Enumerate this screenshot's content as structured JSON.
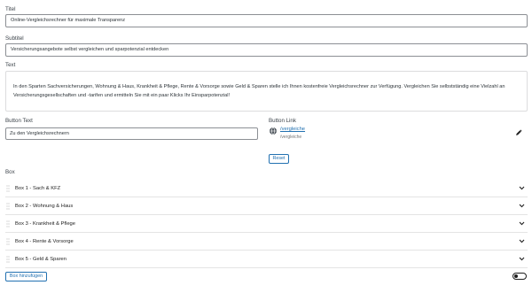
{
  "titel": {
    "label": "Titel",
    "value": "Online-Vergleichsrechner für maximale Transparenz"
  },
  "subtitel": {
    "label": "Subtitel",
    "value": "Versicherungsangebote selbst vergleichen und sparpotenzial entdecken"
  },
  "text": {
    "label": "Text",
    "value": "In den Sparten Sachversicherungen, Wohnung & Haus, Krankheit & Pflege, Rente & Vorsorge sowie Geld & Sparen stelle ich Ihnen kostenfreie Vergleichsrechner zur Verfügung. Vergleichen Sie selbstständig eine Vielzahl an Versicherungsgesellschaften und -tarifen und ermitteln Sie mit ein paar Klicks Ihr Einsparpotenzial!"
  },
  "button_text": {
    "label": "Button Text",
    "value": "Zu den Vergleichsrechnern"
  },
  "button_link": {
    "label": "Button Link",
    "url": "/vergleiche",
    "sub": "/vergleiche",
    "globe_icon": "globe-icon",
    "edit_icon": "pencil-icon"
  },
  "reset_label": "Reset",
  "box_section": {
    "label": "Box",
    "items": [
      {
        "label": "Box 1 - Sach & KFZ"
      },
      {
        "label": "Box 2 - Wohnung & Haus"
      },
      {
        "label": "Box 3 - Krankheit & Pflege"
      },
      {
        "label": "Box 4 - Rente & Vorsorge"
      },
      {
        "label": "Box 5 - Geld & Sparen"
      }
    ],
    "handle_icon": "drag-handle-icon",
    "chevron_icon": "chevron-down-icon"
  },
  "add_box_label": "Box hinzufügen",
  "toggle": {
    "state": "off"
  },
  "colors": {
    "accent": "#2271b1",
    "text": "#1e1e1e",
    "border": "#8c8f94"
  }
}
